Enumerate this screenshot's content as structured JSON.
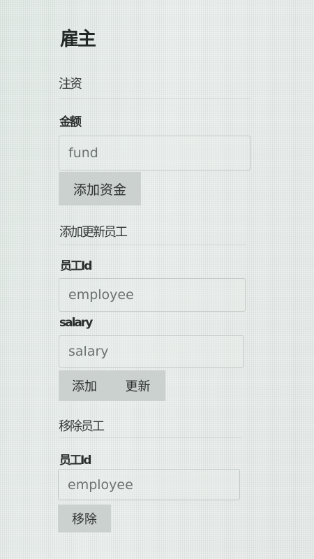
{
  "page": {
    "title": "雇主"
  },
  "invest": {
    "heading": "注资",
    "amount_label": "金额",
    "amount_placeholder": "fund",
    "submit_label": "添加资金"
  },
  "employee_form": {
    "heading": "添加更新员工",
    "id_label": "员工Id",
    "id_placeholder": "employee",
    "salary_label": "salary",
    "salary_placeholder": "salary",
    "add_label": "添加",
    "update_label": "更新"
  },
  "remove_form": {
    "heading": "移除员工",
    "id_label": "员工Id",
    "id_placeholder": "employee",
    "remove_label": "移除"
  }
}
